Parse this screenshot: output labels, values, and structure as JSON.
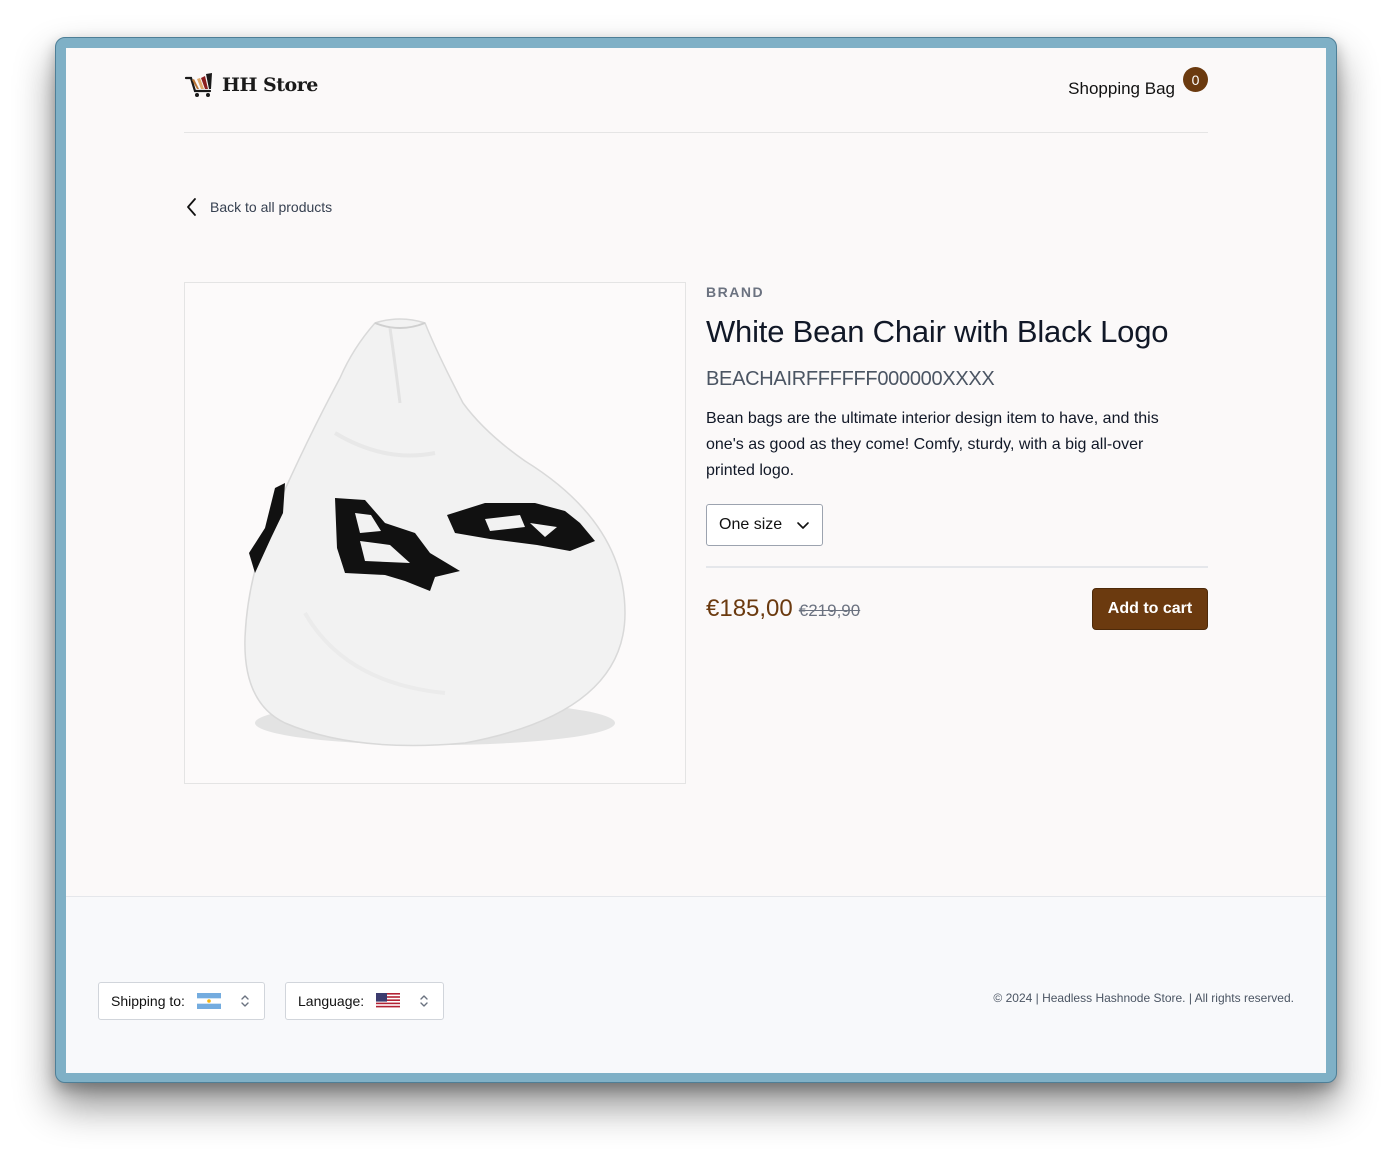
{
  "header": {
    "logo_text": "HH Store",
    "bag_label": "Shopping Bag",
    "bag_count": "0"
  },
  "nav": {
    "back_label": "Back to all products"
  },
  "product": {
    "brand": "BRAND",
    "title": "White Bean Chair with Black Logo",
    "sku": "BEACHAIRFFFFFF000000XXXX",
    "description": "Bean bags are the ultimate interior design item to have, and this one's as good as they come! Comfy, sturdy, with a big all-over printed logo.",
    "size_selected": "One size",
    "price_current": "€185,00",
    "price_original": "€219,90",
    "add_to_cart_label": "Add to cart"
  },
  "footer": {
    "shipping_label": "Shipping to:",
    "shipping_flag": "argentina-flag",
    "language_label": "Language:",
    "language_flag": "us-flag",
    "copyright": "© 2024 | Headless Hashnode Store. | All rights reserved."
  },
  "colors": {
    "accent": "#6b3a0f",
    "frame": "#7fb0c6",
    "page_bg": "#fbf9f9",
    "footer_bg": "#f8f9fb"
  }
}
